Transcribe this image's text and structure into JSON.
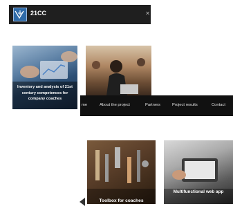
{
  "header": {
    "brand": "21CC",
    "logo_icon": "21cc-logo-icon",
    "close_icon": "close-icon"
  },
  "hero": [
    {
      "title": "Inventory and analysis of 21st century competences for company coaches"
    },
    {
      "title": ""
    }
  ],
  "nav": {
    "items": [
      {
        "label": "me"
      },
      {
        "label": "About the project"
      },
      {
        "label": "Partners"
      },
      {
        "label": "Project results"
      },
      {
        "label": "Contact"
      }
    ]
  },
  "cards": [
    {
      "title": "Toolbox for coaches"
    },
    {
      "title": "Multifunctional web app"
    }
  ]
}
